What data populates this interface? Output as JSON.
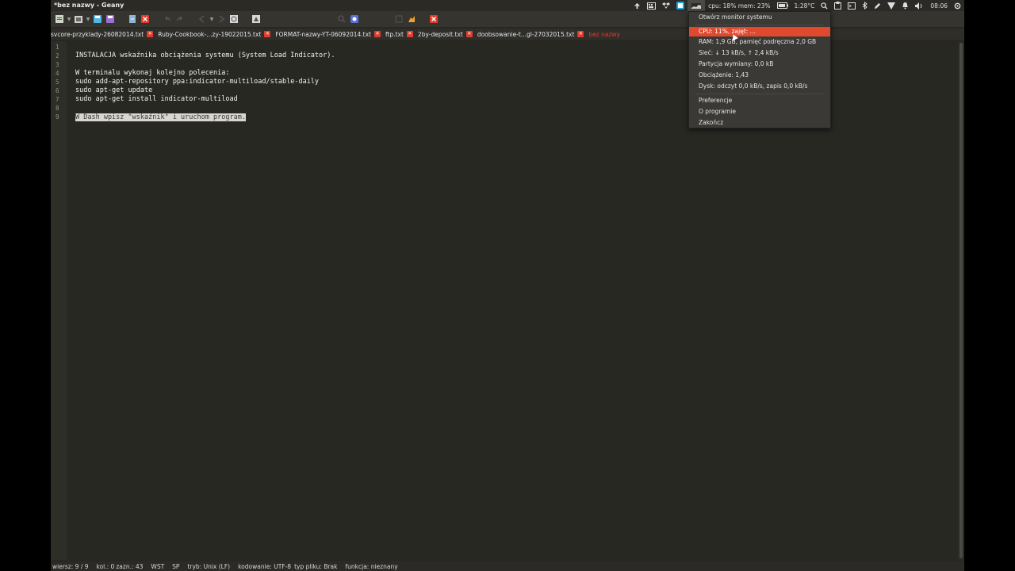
{
  "window": {
    "title": "*bez nazwy - Geany"
  },
  "panel": {
    "system_monitor_text": "cpu: 18% mem: 23%",
    "temperature": "1:28°C",
    "clock": "08:06"
  },
  "tabs": [
    {
      "label": "svcore-przyklady-26082014.txt"
    },
    {
      "label": "Ruby-Cookbook-...zy-19022015.txt"
    },
    {
      "label": "FORMAT-nazwy-YT-06092014.txt"
    },
    {
      "label": "ftp.txt"
    },
    {
      "label": "2by-deposit.txt"
    },
    {
      "label": "doobsowanie-t...gl-27032015.txt"
    },
    {
      "label": "bez nazwy"
    }
  ],
  "editor": {
    "lines": [
      {
        "no": "1",
        "text": ""
      },
      {
        "no": "2",
        "text": "INSTALACJA wskaźnika obciążenia systemu (System Load Indicator)."
      },
      {
        "no": "3",
        "text": ""
      },
      {
        "no": "4",
        "text": "W terminalu wykonaj kolejno polecenia:"
      },
      {
        "no": "5",
        "text": "sudo add-apt-repository ppa:indicator-multiload/stable-daily"
      },
      {
        "no": "6",
        "text": "sudo apt-get update"
      },
      {
        "no": "7",
        "text": "sudo apt-get install indicator-multiload"
      },
      {
        "no": "8",
        "text": ""
      },
      {
        "no": "9",
        "text": "W Dash wpisz \"wskaźnik\" i uruchom program."
      }
    ]
  },
  "statusbar": {
    "line": "wiersz: 9 / 9",
    "col": "kol.: 0",
    "sel": "zazn.: 43",
    "ins": "WST",
    "tab": "SP",
    "mode": "tryb: Unix (LF)",
    "encoding": "kodowanie: UTF-8",
    "filetype": "typ pliku: Brak",
    "scope": "funkcja: nieznany"
  },
  "menu": {
    "open_monitor": "Otwórz monitor systemu",
    "cpu": "CPU: 11%, zajęt: ...",
    "mem": "RAM: 1,9 GB, pamięć podręczna 2,0 GB",
    "net": "Sieć: ↓ 13 kB/s, ↑ 2,4 kB/s",
    "swap": "Partycja wymiany: 0,0 kB",
    "load": "Obciążenie: 1,43",
    "disk": "Dysk: odczyt 0,0 kB/s, zapis 0,0 kB/s",
    "preferences": "Preferencje",
    "about": "O programie",
    "quit": "Zakończ"
  },
  "colors": {
    "accent": "#e0492e",
    "editor_bg": "#272822",
    "close_red": "#e03b2b"
  }
}
